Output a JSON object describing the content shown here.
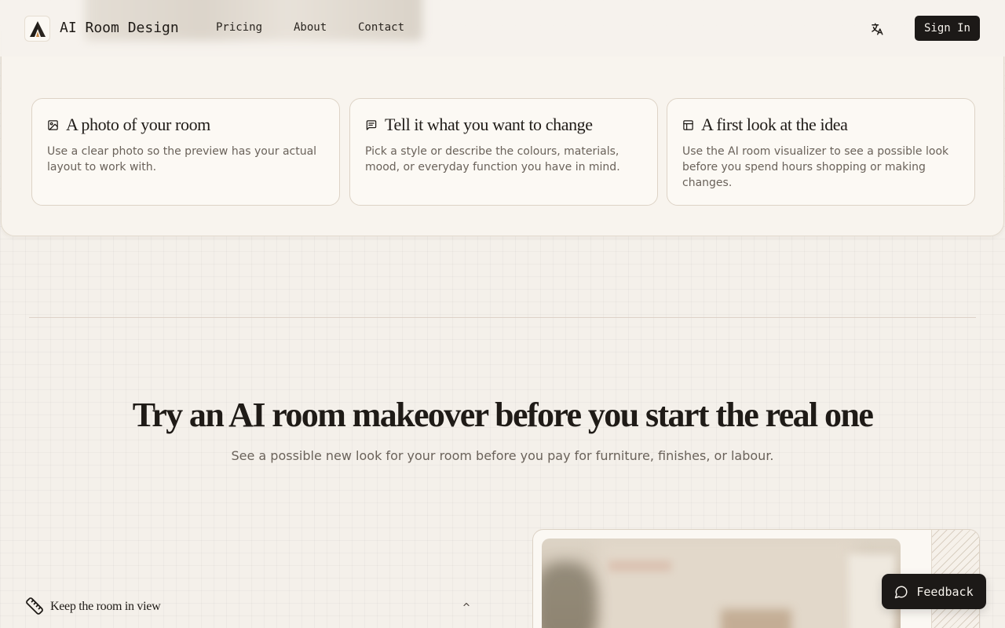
{
  "nav": {
    "brand": "AI Room Design",
    "links": [
      "Pricing",
      "About",
      "Contact"
    ],
    "sign_in": "Sign In",
    "language_icon": "translate-icon"
  },
  "features": [
    {
      "icon": "image-icon",
      "title": "A photo of your room",
      "text": "Use a clear photo so the preview has your actual layout to work with."
    },
    {
      "icon": "message-lines-icon",
      "title": "Tell it what you want to change",
      "text": "Pick a style or describe the colours, materials, mood, or everyday function you have in mind."
    },
    {
      "icon": "layout-icon",
      "title": "A first look at the idea",
      "text": "Use the AI room visualizer to see a possible look before you spend hours shopping or making changes."
    }
  ],
  "hero": {
    "title": "Try an AI room makeover before you start the real one",
    "subtitle": "See a possible new look for your room before you pay for furniture, finishes, or labour."
  },
  "accordion": {
    "label": "Keep the room in view",
    "icon": "ruler-icon",
    "state_icon": "chevron-up-icon"
  },
  "feedback": {
    "label": "Feedback",
    "icon": "chat-bubble-icon"
  },
  "colors": {
    "background": "#f4f0ea",
    "panel": "#f8f4ee",
    "dark_button": "#1c1917",
    "text": "#1f1b17",
    "muted_text": "#6a625a"
  }
}
